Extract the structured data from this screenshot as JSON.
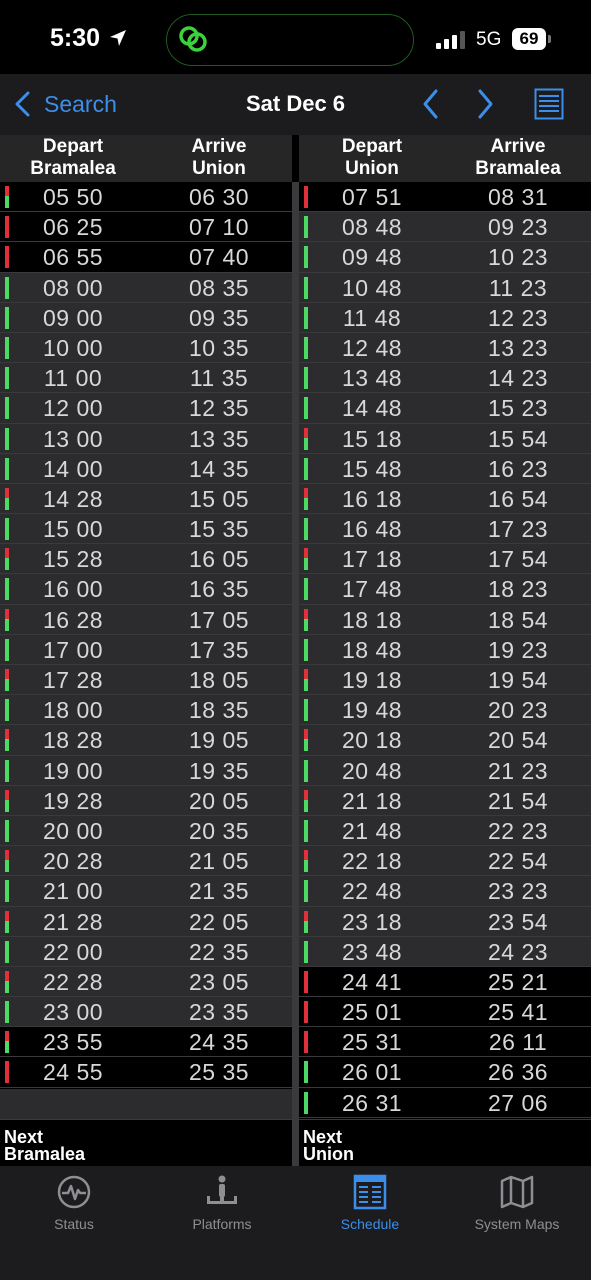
{
  "status_bar": {
    "time": "5:30",
    "network": "5G",
    "battery": "69"
  },
  "nav": {
    "back_label": "Search",
    "title": "Sat Dec 6"
  },
  "left": {
    "depart_header": "Depart\nBramalea",
    "arrive_header": "Arrive\nUnion",
    "next_label": "Next\nBramalea",
    "rows": [
      {
        "depart": "05 50",
        "arrive": "06 30",
        "status": "red-green",
        "dark": true
      },
      {
        "depart": "06 25",
        "arrive": "07 10",
        "status": "red",
        "dark": true
      },
      {
        "depart": "06 55",
        "arrive": "07 40",
        "status": "red",
        "dark": true
      },
      {
        "depart": "08 00",
        "arrive": "08 35",
        "status": "green",
        "dark": false
      },
      {
        "depart": "09 00",
        "arrive": "09 35",
        "status": "green",
        "dark": false
      },
      {
        "depart": "10 00",
        "arrive": "10 35",
        "status": "green",
        "dark": false
      },
      {
        "depart": "11 00",
        "arrive": "11 35",
        "status": "green",
        "dark": false
      },
      {
        "depart": "12 00",
        "arrive": "12 35",
        "status": "green",
        "dark": false
      },
      {
        "depart": "13 00",
        "arrive": "13 35",
        "status": "green",
        "dark": false
      },
      {
        "depart": "14 00",
        "arrive": "14 35",
        "status": "green",
        "dark": false
      },
      {
        "depart": "14 28",
        "arrive": "15 05",
        "status": "red-green",
        "dark": false
      },
      {
        "depart": "15 00",
        "arrive": "15 35",
        "status": "green",
        "dark": false
      },
      {
        "depart": "15 28",
        "arrive": "16 05",
        "status": "red-green",
        "dark": false
      },
      {
        "depart": "16 00",
        "arrive": "16 35",
        "status": "green",
        "dark": false
      },
      {
        "depart": "16 28",
        "arrive": "17 05",
        "status": "red-green",
        "dark": false
      },
      {
        "depart": "17 00",
        "arrive": "17 35",
        "status": "green",
        "dark": false
      },
      {
        "depart": "17 28",
        "arrive": "18 05",
        "status": "red-green",
        "dark": false
      },
      {
        "depart": "18 00",
        "arrive": "18 35",
        "status": "green",
        "dark": false
      },
      {
        "depart": "18 28",
        "arrive": "19 05",
        "status": "red-green",
        "dark": false
      },
      {
        "depart": "19 00",
        "arrive": "19 35",
        "status": "green",
        "dark": false
      },
      {
        "depart": "19 28",
        "arrive": "20 05",
        "status": "red-green",
        "dark": false
      },
      {
        "depart": "20 00",
        "arrive": "20 35",
        "status": "green",
        "dark": false
      },
      {
        "depart": "20 28",
        "arrive": "21 05",
        "status": "red-green",
        "dark": false
      },
      {
        "depart": "21 00",
        "arrive": "21 35",
        "status": "green",
        "dark": false
      },
      {
        "depart": "21 28",
        "arrive": "22 05",
        "status": "red-green",
        "dark": false
      },
      {
        "depart": "22 00",
        "arrive": "22 35",
        "status": "green",
        "dark": false
      },
      {
        "depart": "22 28",
        "arrive": "23 05",
        "status": "red-green",
        "dark": false
      },
      {
        "depart": "23 00",
        "arrive": "23 35",
        "status": "green",
        "dark": false
      },
      {
        "depart": "23 55",
        "arrive": "24 35",
        "status": "red-green",
        "dark": true
      },
      {
        "depart": "24 55",
        "arrive": "25 35",
        "status": "red",
        "dark": true
      }
    ]
  },
  "right": {
    "depart_header": "Depart\nUnion",
    "arrive_header": "Arrive\nBramalea",
    "next_label": "Next\nUnion",
    "rows": [
      {
        "depart": "07 51",
        "arrive": "08 31",
        "status": "red",
        "dark": true
      },
      {
        "depart": "08 48",
        "arrive": "09 23",
        "status": "green",
        "dark": false
      },
      {
        "depart": "09 48",
        "arrive": "10 23",
        "status": "green",
        "dark": false
      },
      {
        "depart": "10 48",
        "arrive": "11 23",
        "status": "green",
        "dark": false
      },
      {
        "depart": "11 48",
        "arrive": "12 23",
        "status": "green",
        "dark": false
      },
      {
        "depart": "12 48",
        "arrive": "13 23",
        "status": "green",
        "dark": false
      },
      {
        "depart": "13 48",
        "arrive": "14 23",
        "status": "green",
        "dark": false
      },
      {
        "depart": "14 48",
        "arrive": "15 23",
        "status": "green",
        "dark": false
      },
      {
        "depart": "15 18",
        "arrive": "15 54",
        "status": "red-green",
        "dark": false
      },
      {
        "depart": "15 48",
        "arrive": "16 23",
        "status": "green",
        "dark": false
      },
      {
        "depart": "16 18",
        "arrive": "16 54",
        "status": "red-green",
        "dark": false
      },
      {
        "depart": "16 48",
        "arrive": "17 23",
        "status": "green",
        "dark": false
      },
      {
        "depart": "17 18",
        "arrive": "17 54",
        "status": "red-green",
        "dark": false
      },
      {
        "depart": "17 48",
        "arrive": "18 23",
        "status": "green",
        "dark": false
      },
      {
        "depart": "18 18",
        "arrive": "18 54",
        "status": "red-green",
        "dark": false
      },
      {
        "depart": "18 48",
        "arrive": "19 23",
        "status": "green",
        "dark": false
      },
      {
        "depart": "19 18",
        "arrive": "19 54",
        "status": "red-green",
        "dark": false
      },
      {
        "depart": "19 48",
        "arrive": "20 23",
        "status": "green",
        "dark": false
      },
      {
        "depart": "20 18",
        "arrive": "20 54",
        "status": "red-green",
        "dark": false
      },
      {
        "depart": "20 48",
        "arrive": "21 23",
        "status": "green",
        "dark": false
      },
      {
        "depart": "21 18",
        "arrive": "21 54",
        "status": "red-green",
        "dark": false
      },
      {
        "depart": "21 48",
        "arrive": "22 23",
        "status": "green",
        "dark": false
      },
      {
        "depart": "22 18",
        "arrive": "22 54",
        "status": "red-green",
        "dark": false
      },
      {
        "depart": "22 48",
        "arrive": "23 23",
        "status": "green",
        "dark": false
      },
      {
        "depart": "23 18",
        "arrive": "23 54",
        "status": "red-green",
        "dark": false
      },
      {
        "depart": "23 48",
        "arrive": "24 23",
        "status": "green",
        "dark": false
      },
      {
        "depart": "24 41",
        "arrive": "25 21",
        "status": "red",
        "dark": true
      },
      {
        "depart": "25 01",
        "arrive": "25 41",
        "status": "red",
        "dark": true
      },
      {
        "depart": "25 31",
        "arrive": "26 11",
        "status": "red",
        "dark": true
      },
      {
        "depart": "26 01",
        "arrive": "26 36",
        "status": "green",
        "dark": true
      },
      {
        "depart": "26 31",
        "arrive": "27 06",
        "status": "green",
        "dark": true
      }
    ]
  },
  "tabs": [
    {
      "label": "Status",
      "icon": "pulse-icon",
      "active": false
    },
    {
      "label": "Platforms",
      "icon": "platform-icon",
      "active": false
    },
    {
      "label": "Schedule",
      "icon": "schedule-icon",
      "active": true
    },
    {
      "label": "System Maps",
      "icon": "map-icon",
      "active": false
    }
  ],
  "colors": {
    "accent": "#3b8eea",
    "green": "#4cd964",
    "red": "#e0303a",
    "row_bg": "#2c2c2e",
    "header_bg": "#262626"
  }
}
